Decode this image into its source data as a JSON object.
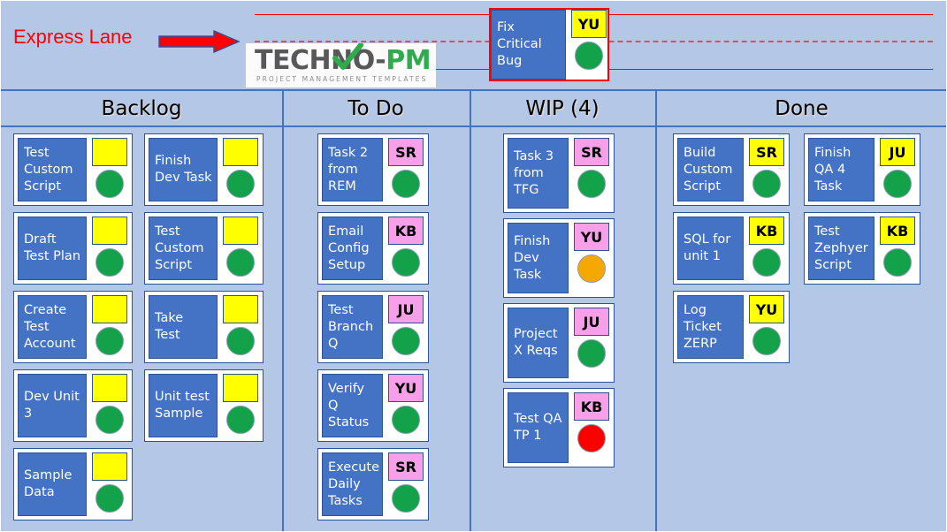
{
  "board": {
    "background_color": "#b4c7e7",
    "grid_color": "#4472c4"
  },
  "express_lane": {
    "label": "Express Lane",
    "label_color": "#ff0000",
    "arrow_icon": "right-arrow-icon",
    "rail_color": "#ff0000",
    "card": {
      "title": "Fix Critical Bug",
      "badge": "YU",
      "badge_color": "#ffff00",
      "status_color": "#13a24a",
      "outline_color": "#ff0000"
    }
  },
  "logo": {
    "word_part1": "TECH",
    "word_part2": "NO-",
    "word_part3": "PM",
    "tagline": "PROJECT MANAGEMENT TEMPLATES",
    "check_icon": "green-check-icon",
    "dark_color": "#58585a",
    "green_color": "#2faa4d"
  },
  "columns": [
    {
      "id": "backlog",
      "header": "Backlog",
      "cards": [
        {
          "title": "Test Custom Script",
          "badge": "",
          "badge_color": "#ffff00",
          "status": "green"
        },
        {
          "title": "Finish Dev Task",
          "badge": "",
          "badge_color": "#ffff00",
          "status": "green"
        },
        {
          "title": "Draft Test Plan",
          "badge": "",
          "badge_color": "#ffff00",
          "status": "green"
        },
        {
          "title": "Test Custom Script",
          "badge": "",
          "badge_color": "#ffff00",
          "status": "green"
        },
        {
          "title": "Create Test Account",
          "badge": "",
          "badge_color": "#ffff00",
          "status": "green"
        },
        {
          "title": "Take Test",
          "badge": "",
          "badge_color": "#ffff00",
          "status": "green"
        },
        {
          "title": "Dev Unit 3",
          "badge": "",
          "badge_color": "#ffff00",
          "status": "green"
        },
        {
          "title": "Unit test Sample",
          "badge": "",
          "badge_color": "#ffff00",
          "status": "green"
        },
        {
          "title": "Sample Data",
          "badge": "",
          "badge_color": "#ffff00",
          "status": "green"
        }
      ]
    },
    {
      "id": "todo",
      "header": "To Do",
      "cards": [
        {
          "title": "Task 2 from REM",
          "badge": "SR",
          "badge_color": "#f79fe8",
          "status": "green"
        },
        {
          "title": "Email Config Setup",
          "badge": "KB",
          "badge_color": "#f79fe8",
          "status": "green"
        },
        {
          "title": "Test Branch Q",
          "badge": "JU",
          "badge_color": "#f79fe8",
          "status": "green"
        },
        {
          "title": "Verify Q Status",
          "badge": "YU",
          "badge_color": "#f79fe8",
          "status": "green"
        },
        {
          "title": "Execute Daily Tasks",
          "badge": "SR",
          "badge_color": "#f79fe8",
          "status": "green"
        }
      ]
    },
    {
      "id": "wip",
      "header": "WIP (4)",
      "cards": [
        {
          "title": "Task 3 from TFG",
          "badge": "SR",
          "badge_color": "#f79fe8",
          "status": "green"
        },
        {
          "title": "Finish Dev Task",
          "badge": "YU",
          "badge_color": "#f79fe8",
          "status": "orange"
        },
        {
          "title": "Project X Reqs",
          "badge": "JU",
          "badge_color": "#f79fe8",
          "status": "green"
        },
        {
          "title": "Test QA TP 1",
          "badge": "KB",
          "badge_color": "#f79fe8",
          "status": "red"
        }
      ]
    },
    {
      "id": "done",
      "header": "Done",
      "cards": [
        {
          "title": "Build Custom Script",
          "badge": "SR",
          "badge_color": "#ffff00",
          "status": "green"
        },
        {
          "title": "Finish QA 4 Task",
          "badge": "JU",
          "badge_color": "#ffff00",
          "status": "green"
        },
        {
          "title": "SQL for unit 1",
          "badge": "KB",
          "badge_color": "#ffff00",
          "status": "green"
        },
        {
          "title": "Test Zephyer Script",
          "badge": "KB",
          "badge_color": "#ffff00",
          "status": "green"
        },
        {
          "title": "Log Ticket ZERP",
          "badge": "YU",
          "badge_color": "#ffff00",
          "status": "green"
        }
      ]
    }
  ],
  "status_colors": {
    "green": "#13a24a",
    "orange": "#f5a800",
    "red": "#fc0000"
  }
}
